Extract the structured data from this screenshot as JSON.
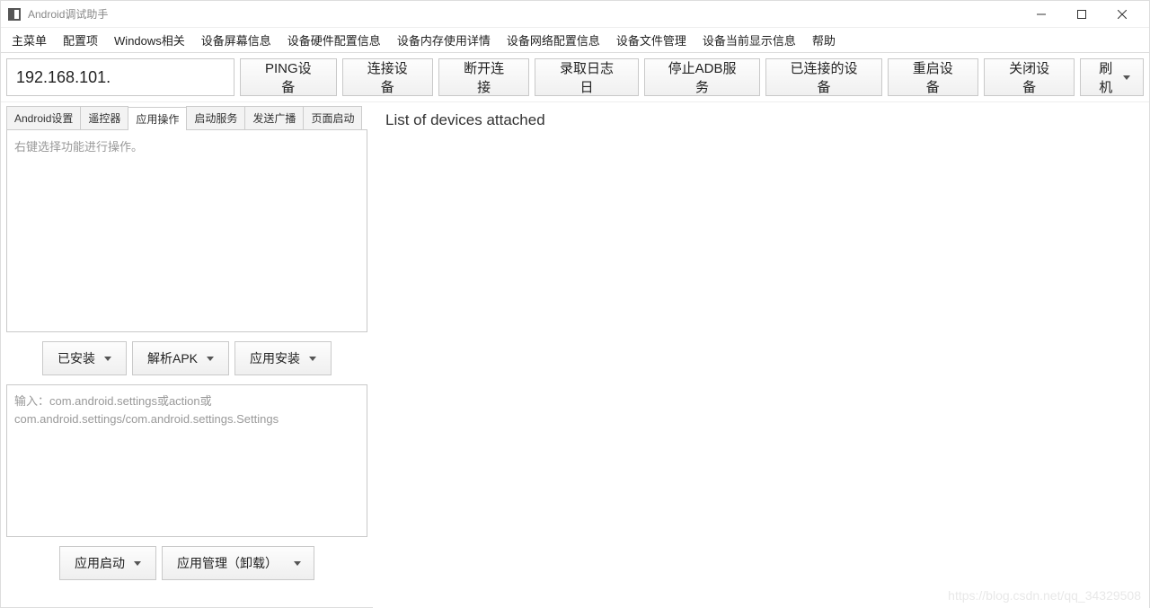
{
  "titlebar": {
    "title": "Android调试助手"
  },
  "menubar": {
    "items": [
      "主菜单",
      "配置项",
      "Windows相关",
      "设备屏幕信息",
      "设备硬件配置信息",
      "设备内存使用详情",
      "设备网络配置信息",
      "设备文件管理",
      "设备当前显示信息",
      "帮助"
    ]
  },
  "toolbar": {
    "ip_value": "192.168.101.",
    "buttons": {
      "ping": "PING设备",
      "connect": "连接设备",
      "disconnect": "断开连接",
      "record_log": "录取日志日",
      "stop_adb": "停止ADB服务",
      "connected_devices": "已连接的设备",
      "reboot": "重启设备",
      "shutdown": "关闭设备",
      "flash": "刷机"
    }
  },
  "tabs": {
    "items": [
      "Android设置",
      "遥控器",
      "应用操作",
      "启动服务",
      "发送广播",
      "页面启动"
    ],
    "active_index": 2
  },
  "panel": {
    "upper_placeholder": "右键选择功能进行操作。",
    "mid_buttons": {
      "installed": "已安装",
      "parse_apk": "解析APK",
      "install_app": "应用安装"
    },
    "lower_placeholder": "输入：com.android.settings或action或com.android.settings/com.android.settings.Settings",
    "bot_buttons": {
      "launch_app": "应用启动",
      "app_manage": "应用管理（卸载）"
    }
  },
  "output": {
    "text": "List of devices attached"
  },
  "watermark": "https://blog.csdn.net/qq_34329508"
}
